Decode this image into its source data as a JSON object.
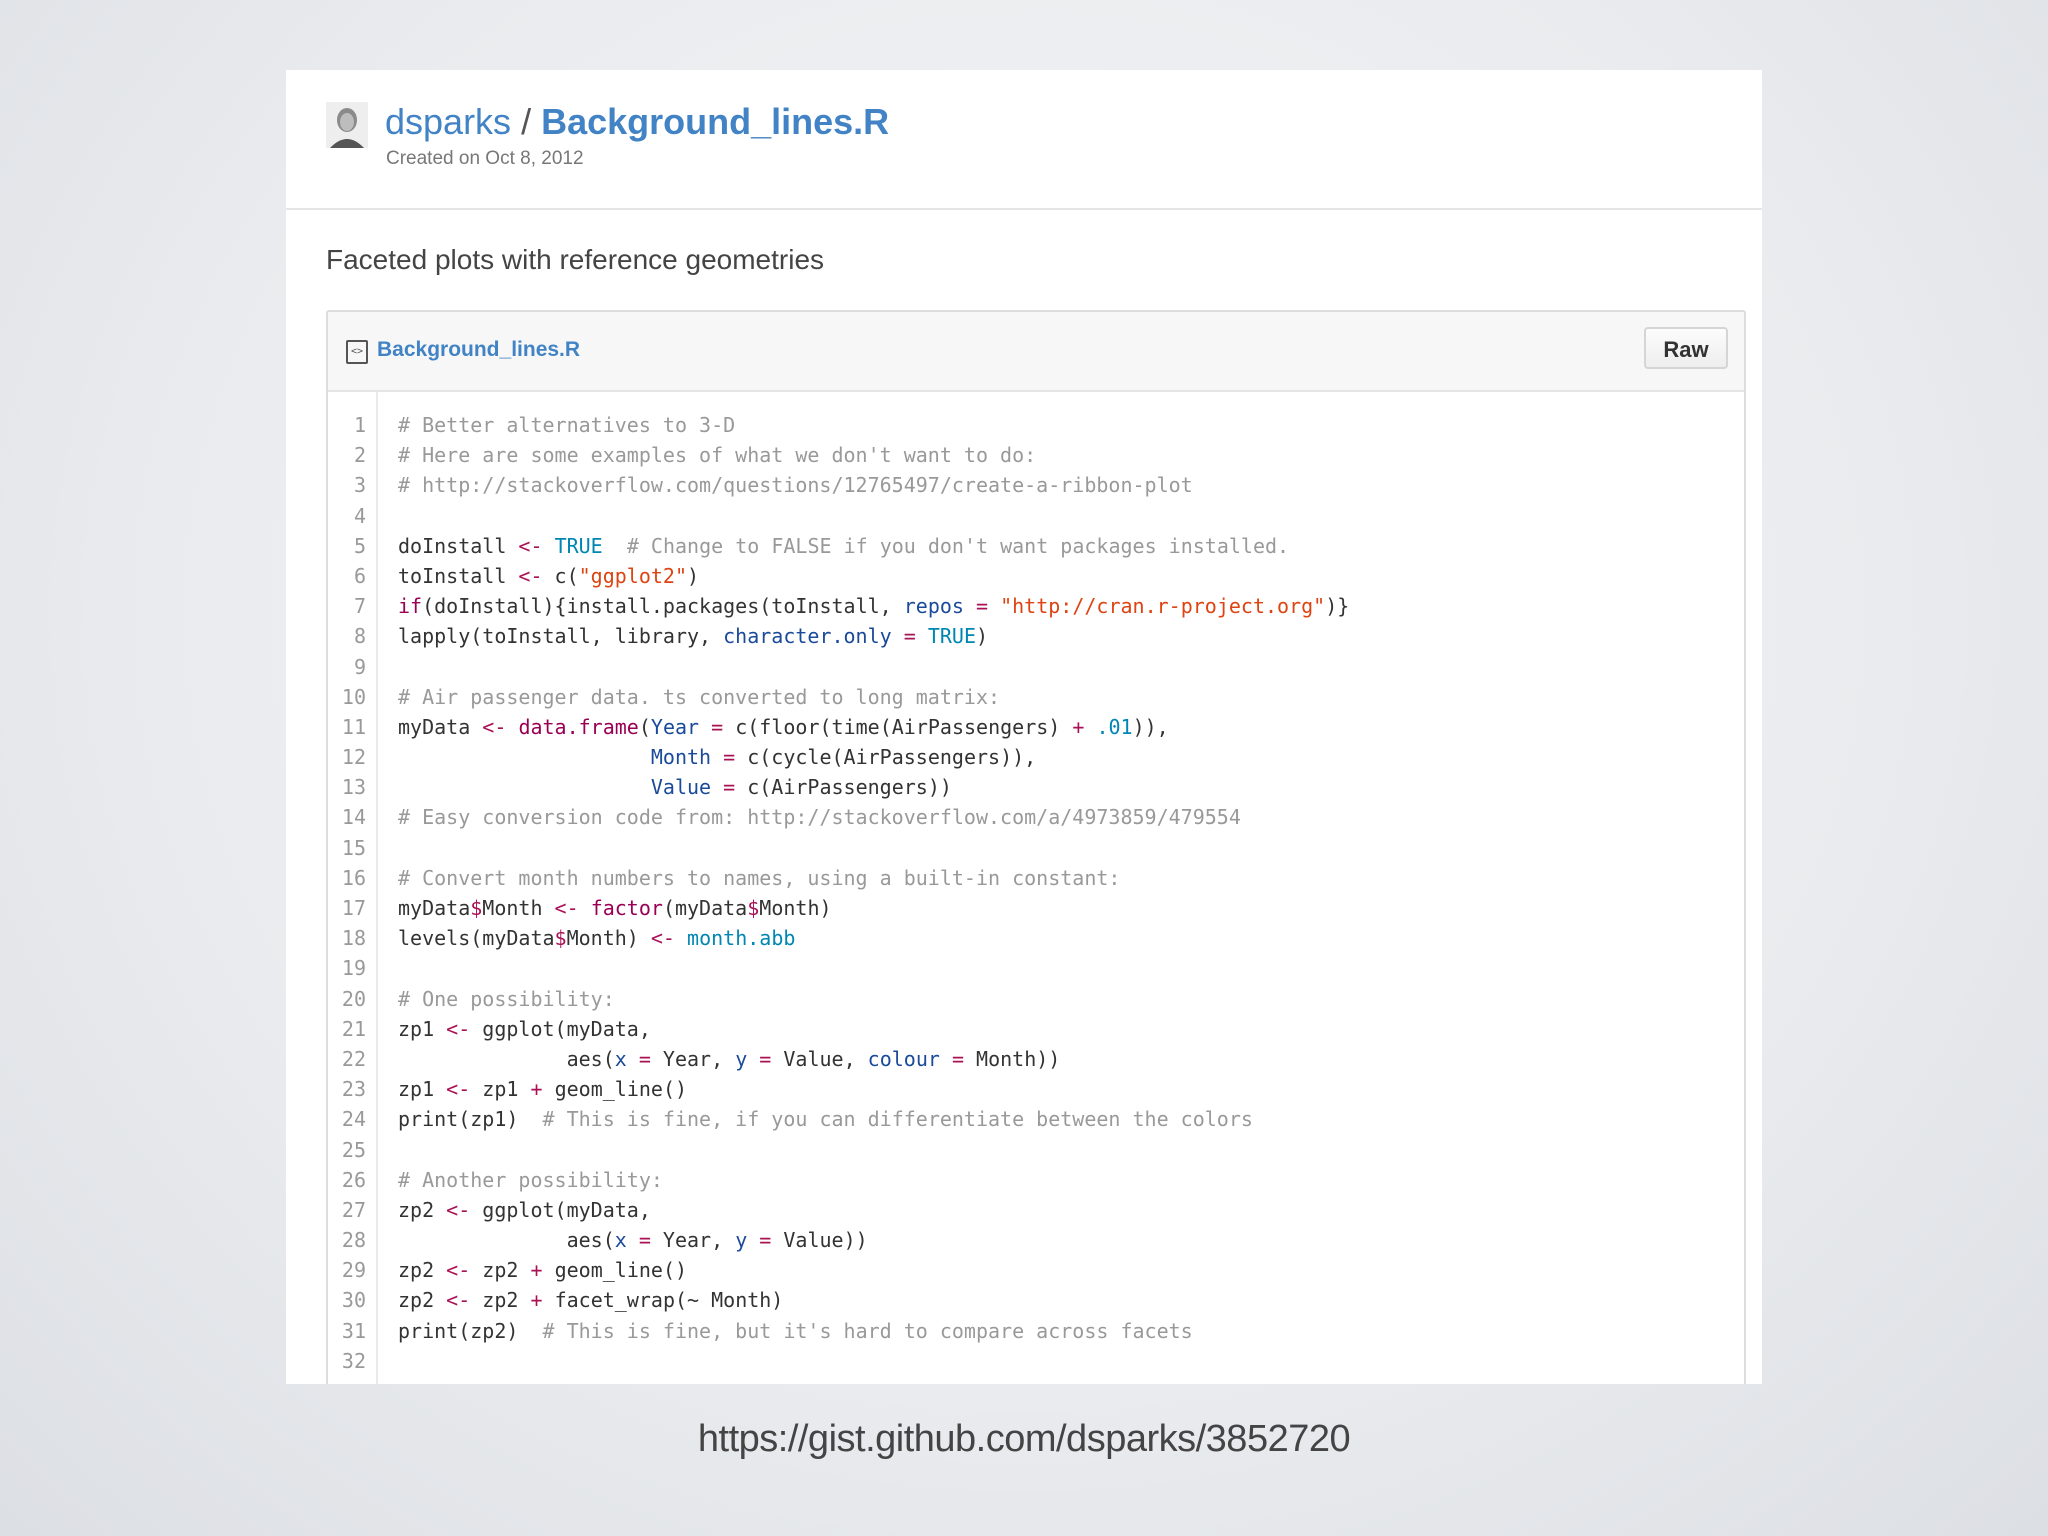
{
  "header": {
    "user": "dsparks",
    "separator": " / ",
    "gist_title": "Background_lines.R",
    "created": "Created on Oct 8, 2012"
  },
  "description": "Faceted plots with reference geometries",
  "file": {
    "name": "Background_lines.R",
    "raw_label": "Raw"
  },
  "code_lines": [
    [
      [
        "c",
        "# Better alternatives to 3-D"
      ]
    ],
    [
      [
        "c",
        "# Here are some examples of what we don't want to do:"
      ]
    ],
    [
      [
        "c",
        "# http://stackoverflow.com/questions/12765497/create-a-ribbon-plot"
      ]
    ],
    [],
    [
      [
        "t",
        "doInstall "
      ],
      [
        "o",
        "<-"
      ],
      [
        "t",
        " "
      ],
      [
        "k",
        "TRUE"
      ],
      [
        "t",
        "  "
      ],
      [
        "c",
        "# Change to FALSE if you don't want packages installed."
      ]
    ],
    [
      [
        "t",
        "toInstall "
      ],
      [
        "o",
        "<-"
      ],
      [
        "t",
        " c("
      ],
      [
        "s",
        "\"ggplot2\""
      ],
      [
        "t",
        ")"
      ]
    ],
    [
      [
        "f",
        "if"
      ],
      [
        "t",
        "(doInstall){install.packages(toInstall, "
      ],
      [
        "a",
        "repos"
      ],
      [
        "t",
        " "
      ],
      [
        "o",
        "="
      ],
      [
        "t",
        " "
      ],
      [
        "s",
        "\"http://cran.r-project.org\""
      ],
      [
        "t",
        ")}"
      ]
    ],
    [
      [
        "t",
        "lapply(toInstall, library, "
      ],
      [
        "a",
        "character.only"
      ],
      [
        "t",
        " "
      ],
      [
        "o",
        "="
      ],
      [
        "t",
        " "
      ],
      [
        "k",
        "TRUE"
      ],
      [
        "t",
        ")"
      ]
    ],
    [],
    [
      [
        "c",
        "# Air passenger data. ts converted to long matrix:"
      ]
    ],
    [
      [
        "t",
        "myData "
      ],
      [
        "o",
        "<-"
      ],
      [
        "t",
        " "
      ],
      [
        "f",
        "data.frame"
      ],
      [
        "t",
        "("
      ],
      [
        "a",
        "Year"
      ],
      [
        "t",
        " "
      ],
      [
        "o",
        "="
      ],
      [
        "t",
        " c(floor(time(AirPassengers) "
      ],
      [
        "o",
        "+"
      ],
      [
        "t",
        " "
      ],
      [
        "k",
        ".01"
      ],
      [
        "t",
        ")),"
      ]
    ],
    [
      [
        "t",
        "                     "
      ],
      [
        "a",
        "Month"
      ],
      [
        "t",
        " "
      ],
      [
        "o",
        "="
      ],
      [
        "t",
        " c(cycle(AirPassengers)),"
      ]
    ],
    [
      [
        "t",
        "                     "
      ],
      [
        "a",
        "Value"
      ],
      [
        "t",
        " "
      ],
      [
        "o",
        "="
      ],
      [
        "t",
        " c(AirPassengers))"
      ]
    ],
    [
      [
        "c",
        "# Easy conversion code from: http://stackoverflow.com/a/4973859/479554"
      ]
    ],
    [],
    [
      [
        "c",
        "# Convert month numbers to names, using a built-in constant:"
      ]
    ],
    [
      [
        "t",
        "myData"
      ],
      [
        "o",
        "$"
      ],
      [
        "t",
        "Month "
      ],
      [
        "o",
        "<-"
      ],
      [
        "t",
        " "
      ],
      [
        "f",
        "factor"
      ],
      [
        "t",
        "(myData"
      ],
      [
        "o",
        "$"
      ],
      [
        "t",
        "Month)"
      ]
    ],
    [
      [
        "t",
        "levels(myData"
      ],
      [
        "o",
        "$"
      ],
      [
        "t",
        "Month) "
      ],
      [
        "o",
        "<-"
      ],
      [
        "t",
        " "
      ],
      [
        "k",
        "month.abb"
      ]
    ],
    [],
    [
      [
        "c",
        "# One possibility:"
      ]
    ],
    [
      [
        "t",
        "zp1 "
      ],
      [
        "o",
        "<-"
      ],
      [
        "t",
        " ggplot(myData,"
      ]
    ],
    [
      [
        "t",
        "              aes("
      ],
      [
        "a",
        "x"
      ],
      [
        "t",
        " "
      ],
      [
        "o",
        "="
      ],
      [
        "t",
        " Year, "
      ],
      [
        "a",
        "y"
      ],
      [
        "t",
        " "
      ],
      [
        "o",
        "="
      ],
      [
        "t",
        " Value, "
      ],
      [
        "a",
        "colour"
      ],
      [
        "t",
        " "
      ],
      [
        "o",
        "="
      ],
      [
        "t",
        " Month))"
      ]
    ],
    [
      [
        "t",
        "zp1 "
      ],
      [
        "o",
        "<-"
      ],
      [
        "t",
        " zp1 "
      ],
      [
        "o",
        "+"
      ],
      [
        "t",
        " geom_line()"
      ]
    ],
    [
      [
        "t",
        "print(zp1)  "
      ],
      [
        "c",
        "# This is fine, if you can differentiate between the colors"
      ]
    ],
    [],
    [
      [
        "c",
        "# Another possibility:"
      ]
    ],
    [
      [
        "t",
        "zp2 "
      ],
      [
        "o",
        "<-"
      ],
      [
        "t",
        " ggplot(myData,"
      ]
    ],
    [
      [
        "t",
        "              aes("
      ],
      [
        "a",
        "x"
      ],
      [
        "t",
        " "
      ],
      [
        "o",
        "="
      ],
      [
        "t",
        " Year, "
      ],
      [
        "a",
        "y"
      ],
      [
        "t",
        " "
      ],
      [
        "o",
        "="
      ],
      [
        "t",
        " Value))"
      ]
    ],
    [
      [
        "t",
        "zp2 "
      ],
      [
        "o",
        "<-"
      ],
      [
        "t",
        " zp2 "
      ],
      [
        "o",
        "+"
      ],
      [
        "t",
        " geom_line()"
      ]
    ],
    [
      [
        "t",
        "zp2 "
      ],
      [
        "o",
        "<-"
      ],
      [
        "t",
        " zp2 "
      ],
      [
        "o",
        "+"
      ],
      [
        "t",
        " facet_wrap(~ Month)"
      ]
    ],
    [
      [
        "t",
        "print(zp2)  "
      ],
      [
        "c",
        "# This is fine, but it's hard to compare across facets"
      ]
    ],
    []
  ],
  "footer_url": "https://gist.github.com/dsparks/3852720",
  "colors": {
    "link": "#4183c4",
    "comment": "#999999",
    "string": "#dd4411",
    "operator": "#aa1155",
    "constant": "#0086b3"
  }
}
